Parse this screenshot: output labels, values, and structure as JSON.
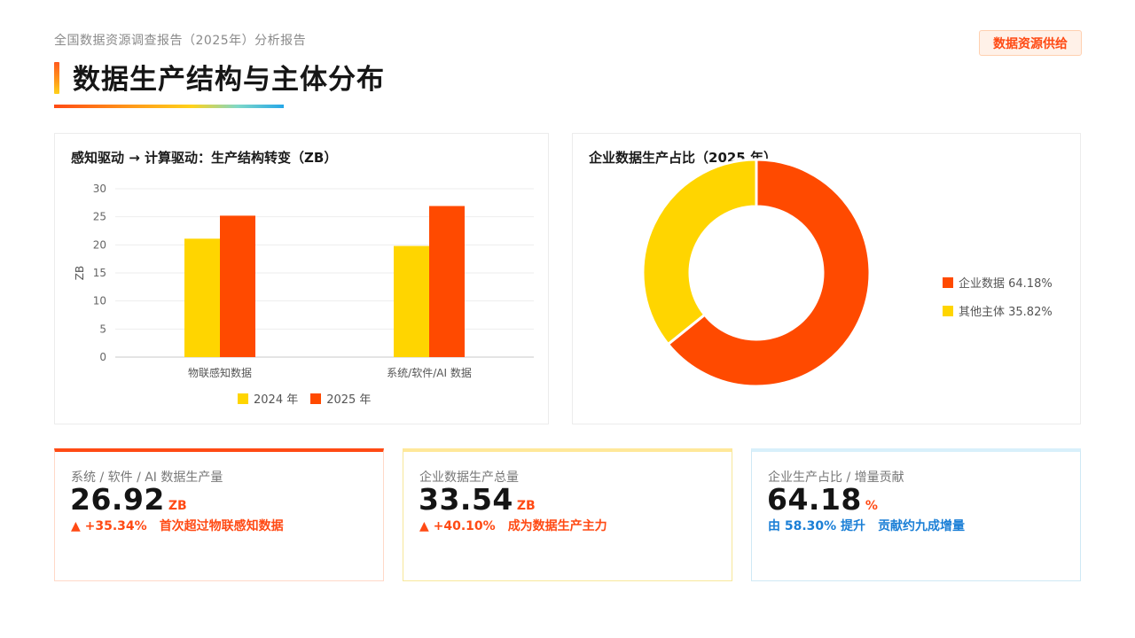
{
  "header": {
    "subtitle": "全国数据资源调查报告（2025年）分析报告",
    "title": "数据生产结构与主体分布",
    "badge": "数据资源供给"
  },
  "bar_panel": {
    "title": "感知驱动 → 计算驱动：生产结构转变（ZB）"
  },
  "pie_panel": {
    "title": "企业数据生产占比（2025 年）"
  },
  "colors": {
    "y2024": "#ffd500",
    "y2025": "#ff4a00",
    "accent": "#ff4a14",
    "blue": "#1b7fd6"
  },
  "chart_data": [
    {
      "type": "bar",
      "title": "感知驱动 → 计算驱动：生产结构转变（ZB）",
      "categories": [
        "物联感知数据",
        "系统/软件/AI 数据"
      ],
      "series": [
        {
          "name": "2024 年",
          "values": [
            21.1,
            19.8
          ]
        },
        {
          "name": "2025 年",
          "values": [
            25.2,
            26.92
          ]
        }
      ],
      "ylabel": "ZB",
      "ylim": [
        0,
        30
      ],
      "yticks": [
        "0",
        "5",
        "10",
        "15",
        "20",
        "25",
        "30"
      ],
      "grid": true,
      "legend": "bottom"
    },
    {
      "type": "pie",
      "title": "企业数据生产占比（2025 年）",
      "slices": [
        {
          "name": "企业数据",
          "value": 64.18,
          "label": "企业数据 64.18%"
        },
        {
          "name": "其他主体",
          "value": 35.82,
          "label": "其他主体 35.82%"
        }
      ],
      "legend": "right"
    }
  ],
  "cards": [
    {
      "label": "系统 / 软件 / AI 数据生产量",
      "value": "26.92",
      "unit": "ZB",
      "change": "▲ +35.34%",
      "note": "首次超过物联感知数据"
    },
    {
      "label": "企业数据生产总量",
      "value": "33.54",
      "unit": "ZB",
      "change": "▲ +40.10%",
      "note": "成为数据生产主力"
    },
    {
      "label": "企业生产占比 / 增量贡献",
      "value": "64.18",
      "unit": "%",
      "change": "由 58.30% 提升",
      "note": "贡献约九成增量"
    }
  ]
}
